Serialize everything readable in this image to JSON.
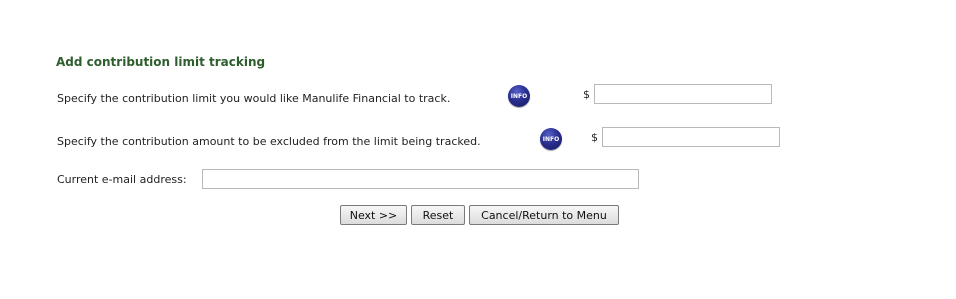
{
  "form": {
    "title": "Add contribution limit tracking",
    "limit_row": {
      "label": "Specify the contribution limit you would like Manulife Financial to track.",
      "info_icon_text": "INFO",
      "currency_symbol": "$",
      "value": ""
    },
    "excluded_row": {
      "label": "Specify the contribution amount to be excluded from the limit being tracked.",
      "info_icon_text": "INFO",
      "currency_symbol": "$",
      "value": ""
    },
    "email_row": {
      "label": "Current e-mail address:",
      "value": ""
    },
    "buttons": {
      "next_label": "Next >>",
      "reset_label": "Reset",
      "cancel_label": "Cancel/Return to Menu"
    }
  },
  "colors": {
    "title": "#2e5e2e",
    "info_icon": "#2a2f8f"
  }
}
